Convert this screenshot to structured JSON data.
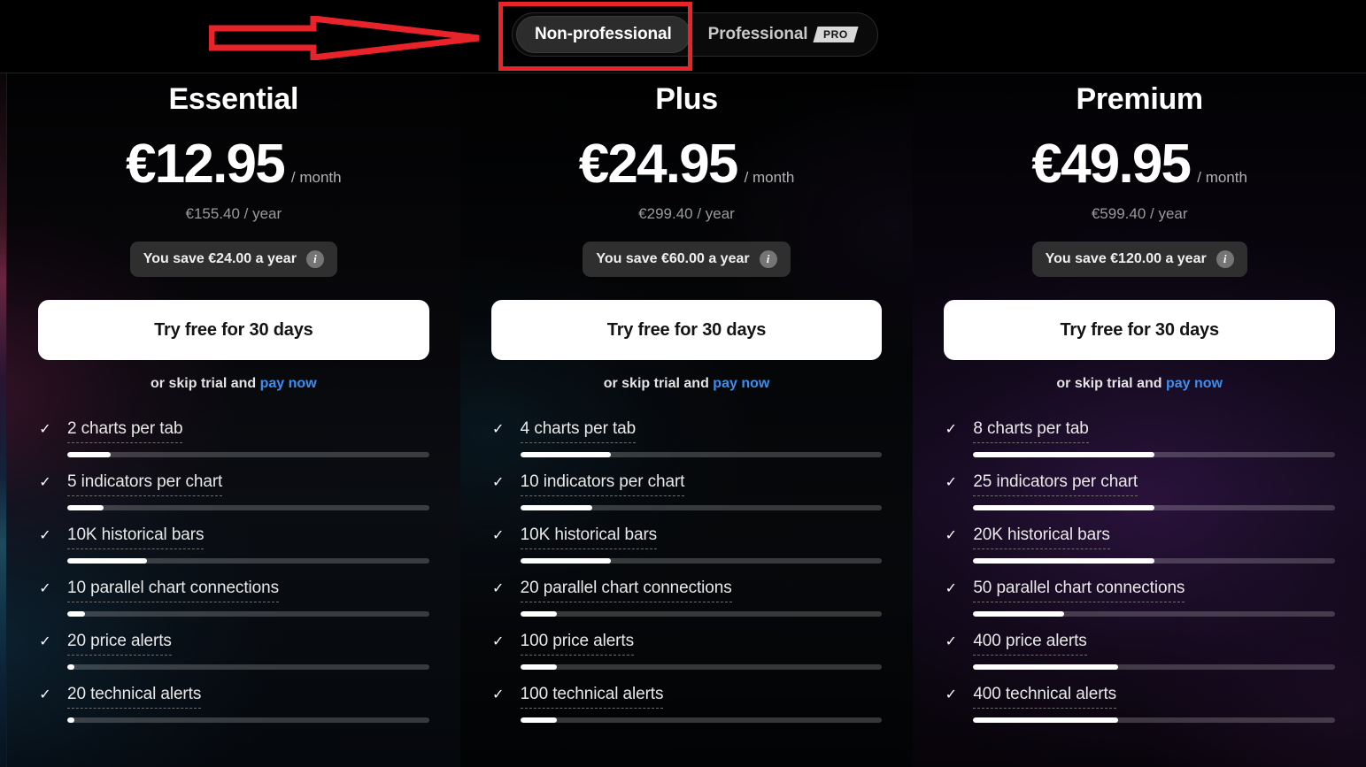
{
  "toggle": {
    "options": [
      {
        "label": "Non-professional",
        "active": true,
        "badge": null
      },
      {
        "label": "Professional",
        "active": false,
        "badge": "PRO"
      }
    ]
  },
  "annotation": {
    "color": "#e8232a",
    "shapes": [
      "arrow-right",
      "highlight-rectangle"
    ],
    "points_to": "Non-professional"
  },
  "common": {
    "period_label": "/ month",
    "cta_label": "Try free for 30 days",
    "skip_prefix": "or skip trial and ",
    "skip_link": "pay now",
    "info_glyph": "i",
    "check_glyph": "✓",
    "link_color": "#3b8ff0"
  },
  "plans": [
    {
      "name": "Essential",
      "price": "€12.95",
      "period": "/ month",
      "yearly": "€155.40 / year",
      "save": "You save €24.00 a year",
      "features": [
        {
          "label": "2 charts per tab",
          "fill": 12
        },
        {
          "label": "5 indicators per chart",
          "fill": 10
        },
        {
          "label": "10K historical bars",
          "fill": 22
        },
        {
          "label": "10 parallel chart connections",
          "fill": 5
        },
        {
          "label": "20 price alerts",
          "fill": 2
        },
        {
          "label": "20 technical alerts",
          "fill": 2
        }
      ]
    },
    {
      "name": "Plus",
      "price": "€24.95",
      "period": "/ month",
      "yearly": "€299.40 / year",
      "save": "You save €60.00 a year",
      "features": [
        {
          "label": "4 charts per tab",
          "fill": 25
        },
        {
          "label": "10 indicators per chart",
          "fill": 20
        },
        {
          "label": "10K historical bars",
          "fill": 25
        },
        {
          "label": "20 parallel chart connections",
          "fill": 10
        },
        {
          "label": "100 price alerts",
          "fill": 10
        },
        {
          "label": "100 technical alerts",
          "fill": 10
        }
      ]
    },
    {
      "name": "Premium",
      "price": "€49.95",
      "period": "/ month",
      "yearly": "€599.40 / year",
      "save": "You save €120.00 a year",
      "features": [
        {
          "label": "8 charts per tab",
          "fill": 50
        },
        {
          "label": "25 indicators per chart",
          "fill": 50
        },
        {
          "label": "20K historical bars",
          "fill": 50
        },
        {
          "label": "50 parallel chart connections",
          "fill": 25
        },
        {
          "label": "400 price alerts",
          "fill": 40
        },
        {
          "label": "400 technical alerts",
          "fill": 40
        }
      ]
    }
  ]
}
